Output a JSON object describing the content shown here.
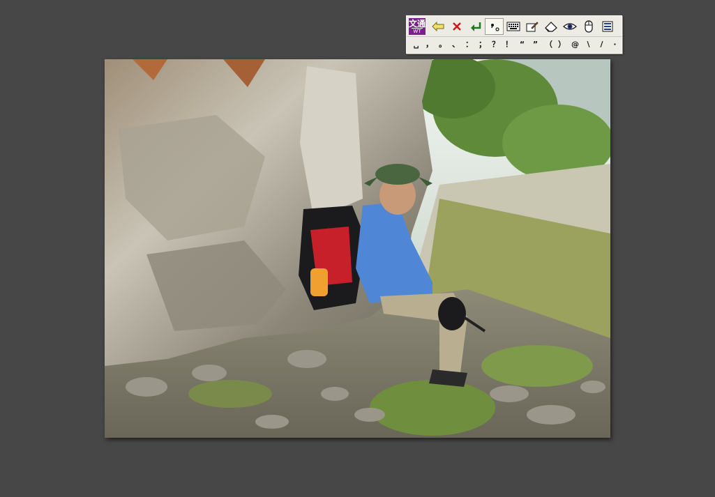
{
  "photo": {
    "description_alt": "hiker-sitting-against-rock-wall",
    "colors": {
      "rock": "#b9b5a8",
      "sky": "#e8efe8",
      "grass": "#7f9a4c",
      "shirt": "#4f86d6",
      "pack": "#c8202a"
    }
  },
  "ime_toolbar": {
    "logo": {
      "top": "文通",
      "bottom": "WT"
    },
    "buttons": [
      {
        "name": "back-arrow-icon"
      },
      {
        "name": "close-x-icon"
      },
      {
        "name": "enter-arrow-icon"
      },
      {
        "name": "punctuation-mode-icon"
      },
      {
        "name": "soft-keyboard-icon"
      },
      {
        "name": "handwriting-icon"
      },
      {
        "name": "eraser-icon"
      },
      {
        "name": "eye-icon"
      },
      {
        "name": "mouse-icon"
      },
      {
        "name": "menu-list-icon"
      }
    ],
    "symbols": [
      "␣",
      "，",
      "。",
      "、",
      "：",
      "；",
      "？",
      "！",
      "“",
      "”",
      "（",
      "）",
      "@",
      "\\",
      "/",
      "·"
    ]
  }
}
